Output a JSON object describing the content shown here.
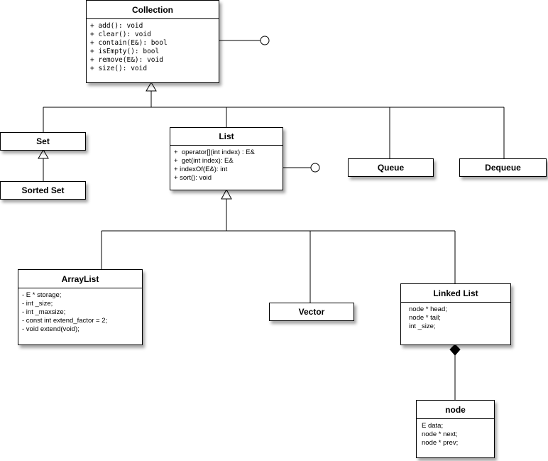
{
  "classes": {
    "collection": {
      "name": "Collection",
      "members": [
        "+ add(): void",
        "+ clear(): void",
        "+ contain(E&): bool",
        "+ isEmpty(): bool",
        "+ remove(E&): void",
        "+ size(): void"
      ]
    },
    "set": {
      "name": "Set"
    },
    "sorted_set": {
      "name": "Sorted Set"
    },
    "list": {
      "name": "List",
      "members": [
        "+  operator[](int index) : E&",
        "+  get(int index): E&",
        "+ indexOf(E&): int",
        "+ sort(): void"
      ]
    },
    "queue": {
      "name": "Queue"
    },
    "dequeue": {
      "name": "Dequeue"
    },
    "arraylist": {
      "name": "ArrayList",
      "members": [
        "- E * storage;",
        "- int _size;",
        "- int _maxsize;",
        "- const int extend_factor = 2;",
        "- void extend(void);"
      ]
    },
    "vector": {
      "name": "Vector"
    },
    "linked_list": {
      "name": "Linked List",
      "members": [
        "node * head;",
        "node * tail;",
        "int _size;"
      ]
    },
    "node": {
      "name": "node",
      "members": [
        "E data;",
        "node * next;",
        "node * prev;"
      ]
    }
  }
}
